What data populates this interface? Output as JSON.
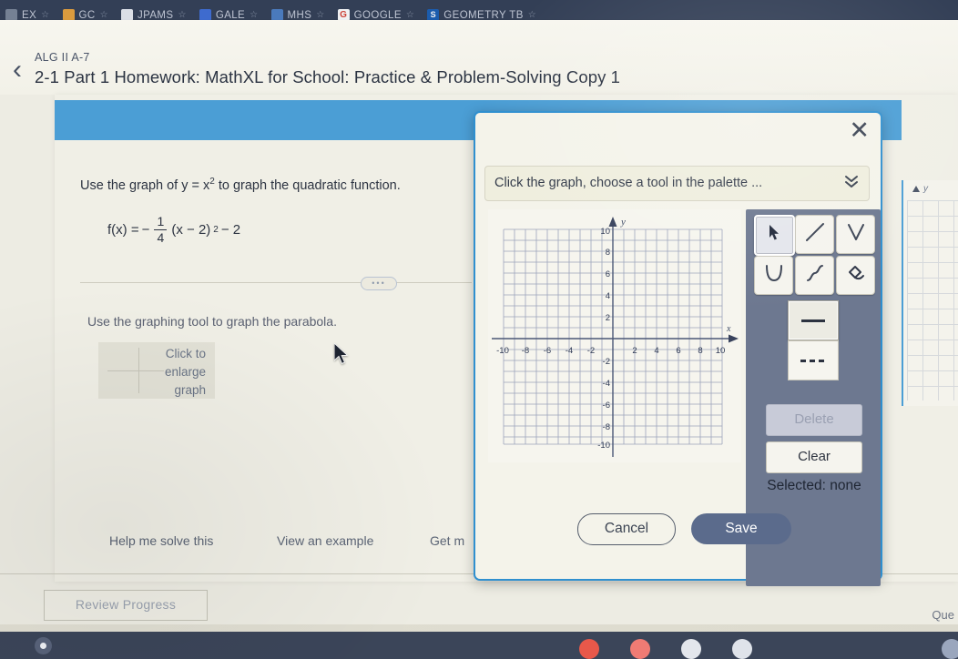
{
  "browser": {
    "bookmarks": [
      {
        "label": "EX",
        "icon": "bookmark-favicon-ex",
        "starred": true
      },
      {
        "label": "GC",
        "icon": "bookmark-favicon-gc",
        "starred": true
      },
      {
        "label": "JPAMS",
        "icon": "bookmark-favicon-jpams",
        "starred": true
      },
      {
        "label": "GALE",
        "icon": "bookmark-favicon-gale",
        "starred": true
      },
      {
        "label": "MHS",
        "icon": "bookmark-favicon-mhs",
        "starred": true
      },
      {
        "label": "GOOGLE",
        "icon": "bookmark-favicon-google",
        "starred": true
      },
      {
        "label": "GEOMETRY TB",
        "icon": "bookmark-favicon-geometry",
        "starred": true
      }
    ],
    "star_glyph": "☆",
    "google_letter": "G",
    "geometry_letter": "S"
  },
  "header": {
    "back_icon": "‹",
    "course_code": "ALG II A-7",
    "assignment_title": "2-1 Part 1 Homework: MathXL for School: Practice & Problem-Solving Copy 1"
  },
  "question": {
    "prompt_prefix": "Use the graph of y = x",
    "prompt_exponent": "2",
    "prompt_suffix": " to graph the quadratic function.",
    "formula": {
      "lhs": "f(x) =",
      "sign": "−",
      "numerator": "1",
      "denominator": "4",
      "body": "(x − 2)",
      "exponent": "2",
      "tail": "− 2"
    },
    "ellipsis": "•••",
    "instruction": "Use the graphing tool to graph the parabola.",
    "enlarge_thumb_label": "Click to\nenlarge\ngraph",
    "enlarge_line1": "Click to",
    "enlarge_line2": "enlarge",
    "enlarge_line3": "graph"
  },
  "help_links": [
    {
      "label": "Help me solve this"
    },
    {
      "label": "View an example"
    },
    {
      "label": "Get m"
    }
  ],
  "footer": {
    "review_progress_label": "Review Progress",
    "question_label": "Que"
  },
  "dialog": {
    "close_glyph": "✕",
    "instruction_text": "Click the graph, choose a tool in the palette ...",
    "chevron_glyph": "»",
    "palette": {
      "tools": [
        {
          "name": "select-arrow-tool",
          "icon": "cursor-arrow-icon",
          "selected": true
        },
        {
          "name": "line-tool",
          "icon": "line-segment-icon",
          "selected": false
        },
        {
          "name": "absolute-value-tool",
          "icon": "v-shape-icon",
          "selected": false
        },
        {
          "name": "parabola-tool",
          "icon": "u-shape-icon",
          "selected": false
        },
        {
          "name": "cubic-curve-tool",
          "icon": "s-curve-icon",
          "selected": false
        },
        {
          "name": "eraser-tool",
          "icon": "eraser-hand-icon",
          "selected": false
        }
      ],
      "styles": [
        {
          "name": "solid-line-style",
          "icon": "solid-line-icon",
          "selected": true
        },
        {
          "name": "dashed-line-style",
          "icon": "dashed-line-icon",
          "selected": false
        }
      ],
      "delete_label": "Delete",
      "delete_disabled": true,
      "clear_label": "Clear",
      "selected_status": "Selected: none"
    },
    "cancel_label": "Cancel",
    "save_label": "Save"
  },
  "chart_data": {
    "type": "scatter",
    "title": "",
    "xlabel": "x",
    "ylabel": "y",
    "xlim": [
      -10,
      10
    ],
    "ylim": [
      -10,
      10
    ],
    "xticks": [
      -10,
      -8,
      -6,
      -4,
      -2,
      2,
      4,
      6,
      8,
      10
    ],
    "yticks": [
      -10,
      -8,
      -6,
      -4,
      -2,
      2,
      4,
      6,
      8,
      10
    ],
    "xtick_labels": [
      "-10",
      "-8",
      "-6",
      "-4",
      "-2",
      "2",
      "4",
      "6",
      "8",
      "10"
    ],
    "ytick_labels": [
      "-10",
      "-8",
      "-6",
      "-4",
      "-2",
      "2",
      "4",
      "6",
      "8",
      "10"
    ],
    "grid": true,
    "grid_step": 1,
    "legend": "none",
    "series": [],
    "annotations": []
  },
  "shelf": {
    "launcher": "launcher-icon",
    "apps": [
      "app-icon-1",
      "app-icon-2",
      "app-icon-3",
      "app-icon-4",
      "app-icon-5"
    ]
  },
  "colors": {
    "banner_blue": "#4b9ed5",
    "dialog_border": "#2f8fcf",
    "palette_bg": "#6d7890",
    "save_button": "#5b6b8c",
    "shelf": "#3b4559",
    "grid_line": "#8b93ad"
  }
}
